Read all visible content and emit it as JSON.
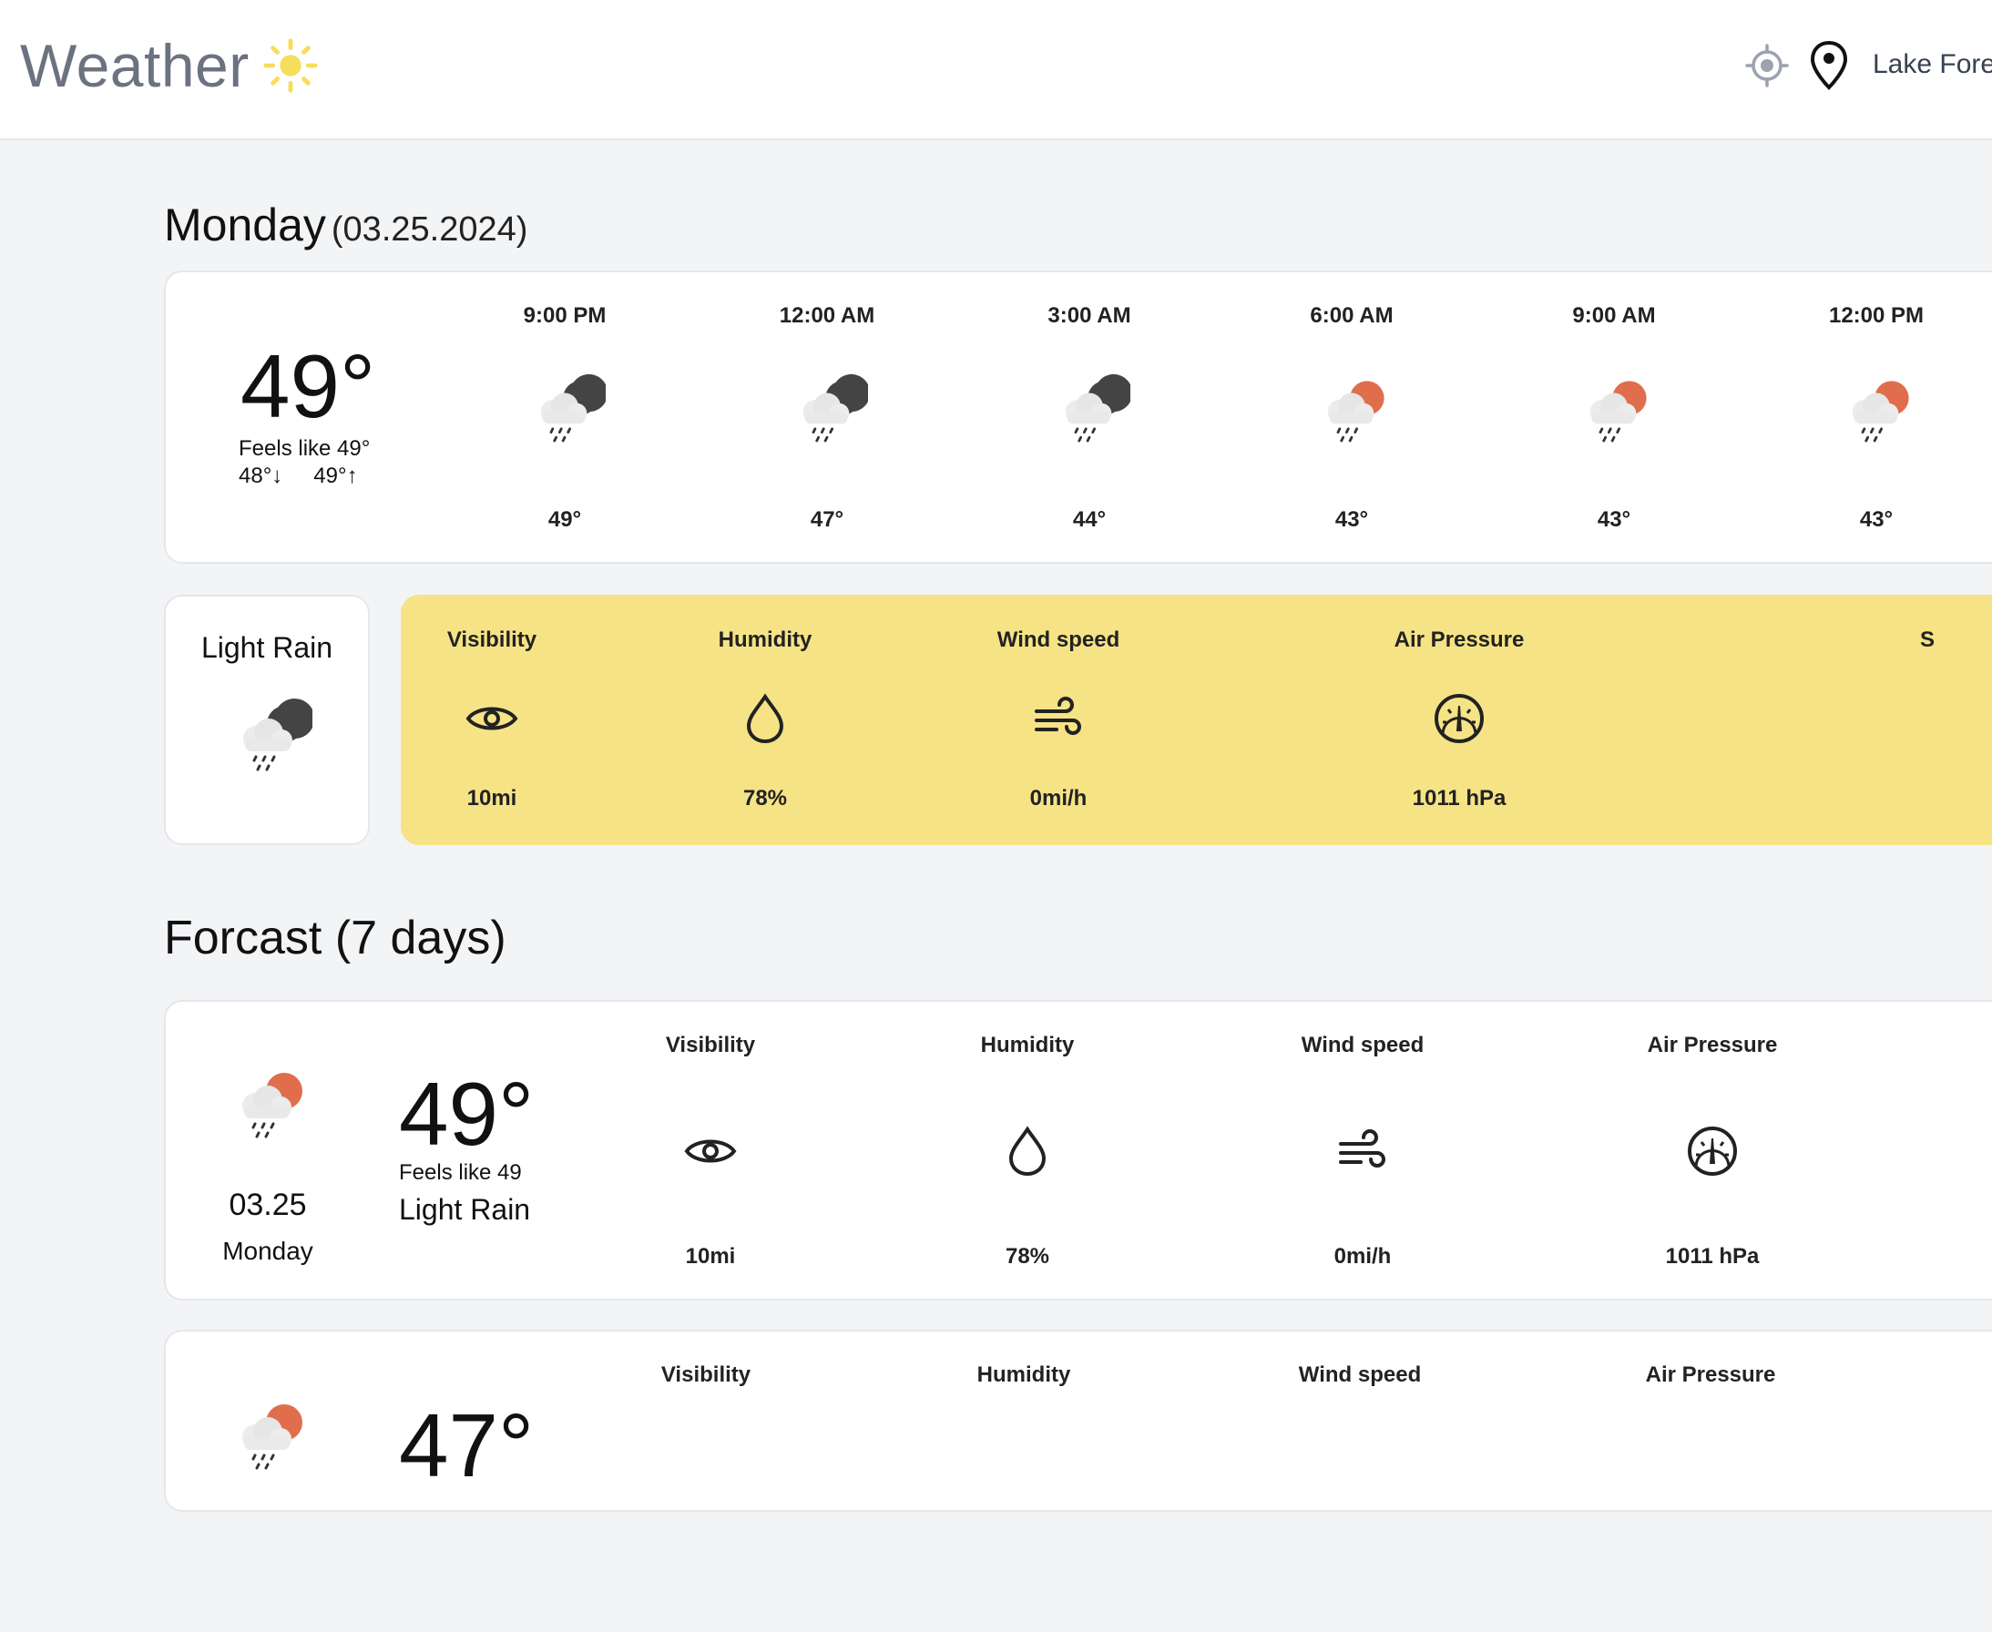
{
  "header": {
    "title": "Weather",
    "location": "Lake Fores"
  },
  "today": {
    "day": "Monday",
    "date": "(03.25.2024)",
    "temp": "49°",
    "feels_like": "Feels like 49°",
    "low": "48°↓",
    "high": "49°↑",
    "condition": "Light Rain",
    "hourly": [
      {
        "time": "9:00 PM",
        "temp": "49°",
        "icon": "rain-night-icon"
      },
      {
        "time": "12:00 AM",
        "temp": "47°",
        "icon": "rain-night-icon"
      },
      {
        "time": "3:00 AM",
        "temp": "44°",
        "icon": "rain-night-icon"
      },
      {
        "time": "6:00 AM",
        "temp": "43°",
        "icon": "rain-day-icon"
      },
      {
        "time": "9:00 AM",
        "temp": "43°",
        "icon": "rain-day-icon"
      },
      {
        "time": "12:00 PM",
        "temp": "43°",
        "icon": "rain-day-icon"
      }
    ],
    "stats": [
      {
        "label": "Visibility",
        "value": "10mi",
        "icon": "eye-icon"
      },
      {
        "label": "Humidity",
        "value": "78%",
        "icon": "droplet-icon"
      },
      {
        "label": "Wind speed",
        "value": "0mi/h",
        "icon": "wind-icon"
      },
      {
        "label": "Air Pressure",
        "value": "1011 hPa",
        "icon": "gauge-icon"
      },
      {
        "label": "S",
        "value": "",
        "icon": ""
      }
    ]
  },
  "forecast": {
    "title": "Forcast (7 days)",
    "days": [
      {
        "date": "03.25",
        "day": "Monday",
        "temp": "49°",
        "feels_like": "Feels like 49",
        "condition": "Light Rain",
        "stats": [
          {
            "label": "Visibility",
            "value": "10mi"
          },
          {
            "label": "Humidity",
            "value": "78%"
          },
          {
            "label": "Wind speed",
            "value": "0mi/h"
          },
          {
            "label": "Air Pressure",
            "value": "1011 hPa"
          }
        ]
      },
      {
        "temp": "47°",
        "stats": [
          {
            "label": "Visibility"
          },
          {
            "label": "Humidity"
          },
          {
            "label": "Wind speed"
          },
          {
            "label": "Air Pressure"
          }
        ]
      }
    ]
  },
  "colors": {
    "sun": "#f6dd5c",
    "moon": "#444444",
    "sun_partial": "#e06e4c",
    "panel": "#f6e385",
    "muted_title": "#6b7280"
  }
}
